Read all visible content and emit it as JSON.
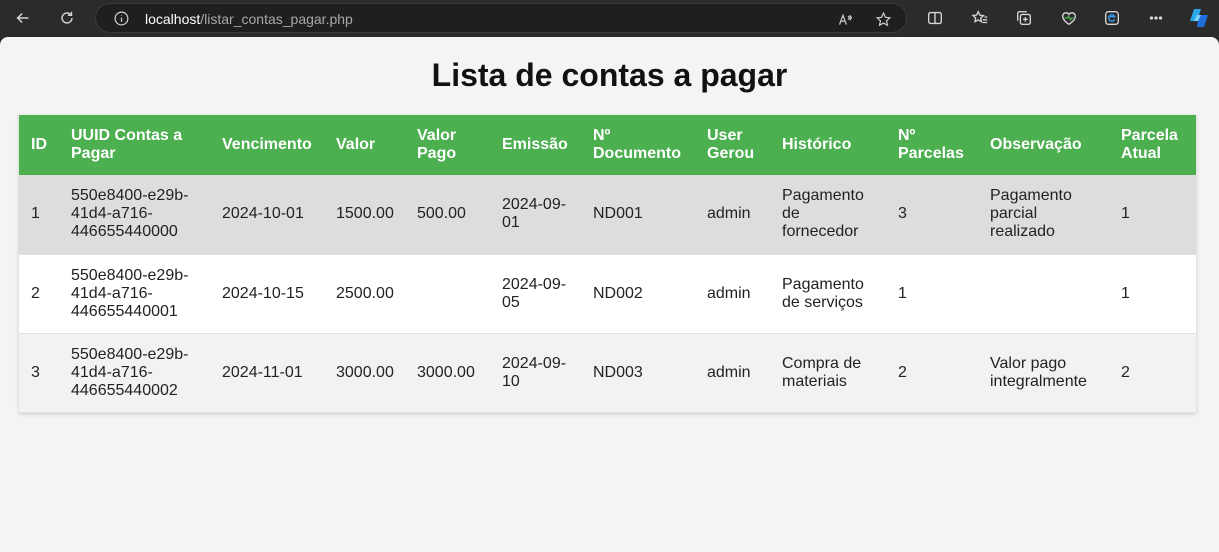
{
  "browser": {
    "url_host": "localhost",
    "url_path": "/listar_contas_pagar.php"
  },
  "page": {
    "title": "Lista de contas a pagar"
  },
  "table": {
    "headers": [
      "ID",
      "UUID Contas a Pagar",
      "Vencimento",
      "Valor",
      "Valor Pago",
      "Emissão",
      "Nº Documento",
      "User Gerou",
      "Histórico",
      "Nº Parcelas",
      "Observação",
      "Parcela Atual"
    ],
    "rows": [
      [
        "1",
        "550e8400-e29b-41d4-a716-446655440000",
        "2024-10-01",
        "1500.00",
        "500.00",
        "2024-09-01",
        "ND001",
        "admin",
        "Pagamento de fornecedor",
        "3",
        "Pagamento parcial realizado",
        "1"
      ],
      [
        "2",
        "550e8400-e29b-41d4-a716-446655440001",
        "2024-10-15",
        "2500.00",
        "",
        "2024-09-05",
        "ND002",
        "admin",
        "Pagamento de serviços",
        "1",
        "",
        "1"
      ],
      [
        "3",
        "550e8400-e29b-41d4-a716-446655440002",
        "2024-11-01",
        "3000.00",
        "3000.00",
        "2024-09-10",
        "ND003",
        "admin",
        "Compra de materiais",
        "2",
        "Valor pago integralmente",
        "2"
      ]
    ]
  },
  "colors": {
    "header_bg": "#4caf50",
    "page_bg": "#f4f4f4"
  }
}
